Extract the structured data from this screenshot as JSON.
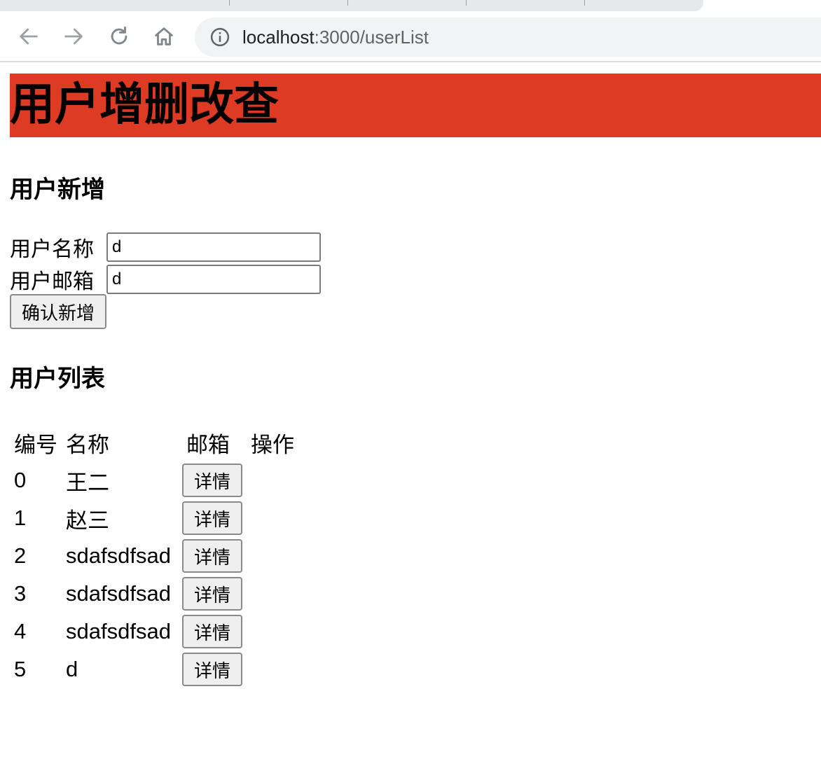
{
  "browser": {
    "url_host": "localhost",
    "url_path": ":3000/userList"
  },
  "page": {
    "title": "用户增删改查",
    "add_section": {
      "heading": "用户新增",
      "name_label": "用户名称",
      "name_value": "d",
      "email_label": "用户邮箱",
      "email_value": "d",
      "submit_label": "确认新增"
    },
    "list_section": {
      "heading": "用户列表",
      "columns": [
        "编号",
        "名称",
        "邮箱",
        "操作"
      ],
      "rows": [
        {
          "id": "0",
          "name": "王二",
          "email": "",
          "action": "详情"
        },
        {
          "id": "1",
          "name": "赵三",
          "email": "",
          "action": "详情"
        },
        {
          "id": "2",
          "name": "sdafsdfsad",
          "email": "",
          "action": "详情"
        },
        {
          "id": "3",
          "name": "sdafsdfsad",
          "email": "",
          "action": "详情"
        },
        {
          "id": "4",
          "name": "sdafsdfsad",
          "email": "",
          "action": "详情"
        },
        {
          "id": "5",
          "name": "d",
          "email": "",
          "action": "详情"
        }
      ]
    }
  },
  "icons": {
    "back": "arrow-left-icon",
    "forward": "arrow-right-icon",
    "reload": "reload-icon",
    "home": "home-icon",
    "info": "info-icon"
  },
  "colors": {
    "banner": "#dd3b23",
    "tabstrip": "#e6e8eb",
    "omnibox": "#f1f3f4"
  }
}
